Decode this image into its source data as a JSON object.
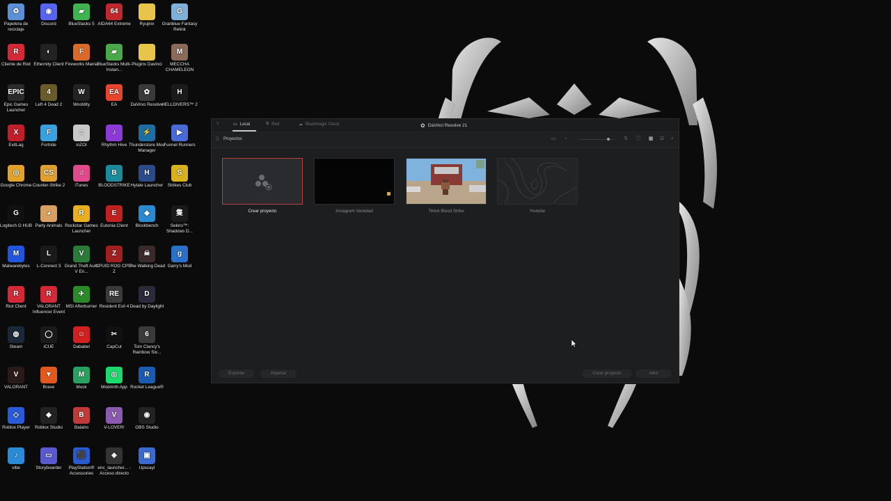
{
  "desktop": {
    "icons": [
      {
        "label": "Papelera de reciclaje",
        "icon": "recycle-bin-icon",
        "color": "#5b8fd6",
        "glyph": "♻"
      },
      {
        "label": "Discord",
        "icon": "discord-icon",
        "color": "#5865f2",
        "glyph": "◉"
      },
      {
        "label": "BlueStacks 5",
        "icon": "bluestacks-icon",
        "color": "#3fb34f",
        "glyph": "▰"
      },
      {
        "label": "AIDA64 Extreme",
        "icon": "aida64-icon",
        "color": "#c0282d",
        "glyph": "64"
      },
      {
        "label": "Ryujinx",
        "icon": "folder-icon",
        "color": "#e8c44a",
        "glyph": ""
      },
      {
        "label": "Granblue Fantasy Relink",
        "icon": "granblue-icon",
        "color": "#7fb0d8",
        "glyph": "G"
      },
      {
        "label": "Cliente de Riot",
        "icon": "riot-icon",
        "color": "#d32936",
        "glyph": "R"
      },
      {
        "label": "Ethernity Client",
        "icon": "ethernity-icon",
        "color": "#222222",
        "glyph": "◐"
      },
      {
        "label": "Fireworks Mania",
        "icon": "fireworks-icon",
        "color": "#d86a2a",
        "glyph": "F"
      },
      {
        "label": "BlueStacks Multi-Instan...",
        "icon": "bluestacks-multi-icon",
        "color": "#4aa84a",
        "glyph": "▰"
      },
      {
        "label": "Plugins Davinci",
        "icon": "folder-icon",
        "color": "#e8c44a",
        "glyph": ""
      },
      {
        "label": "MECCHA CHAMELEON",
        "icon": "meccha-icon",
        "color": "#8a6b5a",
        "glyph": "M"
      },
      {
        "label": "Epic Games Launcher",
        "icon": "epic-games-icon",
        "color": "#2b2b2b",
        "glyph": "EPIC"
      },
      {
        "label": "Left 4 Dead 2",
        "icon": "left4dead-icon",
        "color": "#6b5a2a",
        "glyph": "4"
      },
      {
        "label": "Wootility",
        "icon": "wootility-icon",
        "color": "#222222",
        "glyph": "W"
      },
      {
        "label": "EA",
        "icon": "ea-icon",
        "color": "#e8452c",
        "glyph": "EA"
      },
      {
        "label": "DaVinci Resolve",
        "icon": "davinci-icon",
        "color": "#3a3a3a",
        "glyph": "✿"
      },
      {
        "label": "HELLDIVERS™ 2",
        "icon": "helldivers-icon",
        "color": "#1a1a1a",
        "glyph": "H"
      },
      {
        "label": "ExitLag",
        "icon": "exitlag-icon",
        "color": "#c01f2a",
        "glyph": "X"
      },
      {
        "label": "Fortnite",
        "icon": "fortnite-icon",
        "color": "#3aa0e0",
        "glyph": "F"
      },
      {
        "label": "inZOI",
        "icon": "inzoi-icon",
        "color": "#c8c8c8",
        "glyph": "☺"
      },
      {
        "label": "Rhythm Hive",
        "icon": "rhythm-hive-icon",
        "color": "#8c3ad6",
        "glyph": "♪"
      },
      {
        "label": "Thunderstore Mod Manager",
        "icon": "thunderstore-icon",
        "color": "#1c6ea4",
        "glyph": "⚡"
      },
      {
        "label": "Funnel Runners",
        "icon": "funnel-runners-icon",
        "color": "#4a6ad6",
        "glyph": "▶"
      },
      {
        "label": "Google Chrome",
        "icon": "chrome-icon",
        "color": "#e0a22a",
        "glyph": "◎"
      },
      {
        "label": "Counter-Strike 2",
        "icon": "counter-strike-icon",
        "color": "#e0a030",
        "glyph": "CS"
      },
      {
        "label": "iTunes",
        "icon": "itunes-icon",
        "color": "#e04a8a",
        "glyph": "♫"
      },
      {
        "label": "BLOODSTRIKE",
        "icon": "bloodstrike-icon",
        "color": "#1c8a9a",
        "glyph": "B"
      },
      {
        "label": "Hytale Launcher",
        "icon": "hytale-icon",
        "color": "#2a4a8a",
        "glyph": "H"
      },
      {
        "label": "Strikes Club",
        "icon": "strikes-club-icon",
        "color": "#d8b020",
        "glyph": "S"
      },
      {
        "label": "Logitech G HUB",
        "icon": "logitech-icon",
        "color": "#111111",
        "glyph": "G"
      },
      {
        "label": "Party Animals",
        "icon": "party-animals-icon",
        "color": "#d8a060",
        "glyph": "◕"
      },
      {
        "label": "Rockstar Games Launcher",
        "icon": "rockstar-icon",
        "color": "#e8b020",
        "glyph": "R"
      },
      {
        "label": "Eutonia Client",
        "icon": "eutonia-icon",
        "color": "#c02020",
        "glyph": "E"
      },
      {
        "label": "Blockbench",
        "icon": "blockbench-icon",
        "color": "#2a8ad0",
        "glyph": "◆"
      },
      {
        "label": "Sekiro™: Shadows D...",
        "icon": "sekiro-icon",
        "color": "#1a1a1a",
        "glyph": "隻"
      },
      {
        "label": "Malwarebytes",
        "icon": "malwarebytes-icon",
        "color": "#2255dd",
        "glyph": "M"
      },
      {
        "label": "L-Connect 3",
        "icon": "lconnect-icon",
        "color": "#1a1a1a",
        "glyph": "L"
      },
      {
        "label": "Grand Theft Auto V En...",
        "icon": "gta-icon",
        "color": "#2a7a3a",
        "glyph": "V"
      },
      {
        "label": "CPUID ROG CPU-Z",
        "icon": "cpuz-icon",
        "color": "#a02020",
        "glyph": "Z"
      },
      {
        "label": "The Walking Dead",
        "icon": "walking-dead-icon",
        "color": "#3a2a2a",
        "glyph": "☠"
      },
      {
        "label": "Garry's Mod",
        "icon": "garrys-mod-icon",
        "color": "#2a70c8",
        "glyph": "g"
      },
      {
        "label": "Riot Client",
        "icon": "riot-icon",
        "color": "#d32936",
        "glyph": "R"
      },
      {
        "label": "VALORANT Influencer Event",
        "icon": "riot-icon",
        "color": "#d32936",
        "glyph": "R"
      },
      {
        "label": "MSI Afterburner",
        "icon": "msi-icon",
        "color": "#2a8a2a",
        "glyph": "✈"
      },
      {
        "label": "Resident Evil 4",
        "icon": "resident-evil-icon",
        "color": "#3a3a3a",
        "glyph": "RE"
      },
      {
        "label": "Dead by Daylight",
        "icon": "dbd-icon",
        "color": "#2a2a3a",
        "glyph": "D"
      },
      {
        "label": "Steam",
        "icon": "steam-icon",
        "color": "#1b2838",
        "glyph": "◍"
      },
      {
        "label": "iCUE",
        "icon": "icue-icon",
        "color": "#1a1a1a",
        "glyph": "◯"
      },
      {
        "label": "Dababel",
        "icon": "dababel-icon",
        "color": "#d02020",
        "glyph": "☺"
      },
      {
        "label": "CapCut",
        "icon": "capcut-icon",
        "color": "#111111",
        "glyph": "✂"
      },
      {
        "label": "Tom Clancy's Rainbow Six...",
        "icon": "rainbow-six-icon",
        "color": "#3a3a3a",
        "glyph": "6"
      },
      {
        "label": "VALORANT",
        "icon": "valorant-icon",
        "color": "#2a1a1a",
        "glyph": "V"
      },
      {
        "label": "Brave",
        "icon": "brave-icon",
        "color": "#e05a20",
        "glyph": "▼"
      },
      {
        "label": "Muck",
        "icon": "muck-icon",
        "color": "#2aa060",
        "glyph": "M"
      },
      {
        "label": "Modrinth App",
        "icon": "modrinth-icon",
        "color": "#1bd96a",
        "glyph": "◎"
      },
      {
        "label": "Rocket League®",
        "icon": "rocket-league-icon",
        "color": "#1a5ab0",
        "glyph": "R"
      },
      {
        "label": "Roblox Player",
        "icon": "roblox-icon",
        "color": "#2a5ad8",
        "glyph": "◇"
      },
      {
        "label": "Roblox Studio",
        "icon": "roblox-studio-icon",
        "color": "#222222",
        "glyph": "◆"
      },
      {
        "label": "Balatro",
        "icon": "balatro-icon",
        "color": "#c03a3a",
        "glyph": "B"
      },
      {
        "label": "V-LOVER!",
        "icon": "vlover-icon",
        "color": "#8a5ab0",
        "glyph": "V"
      },
      {
        "label": "OBS Studio",
        "icon": "obs-icon",
        "color": "#222222",
        "glyph": "◉"
      },
      {
        "label": "vibe",
        "icon": "vibe-icon",
        "color": "#2a8ad8",
        "glyph": "♪"
      },
      {
        "label": "Storyboarder",
        "icon": "storyboarder-icon",
        "color": "#5a5ad0",
        "glyph": "▭"
      },
      {
        "label": "PlayStation® Accessories",
        "icon": "playstation-icon",
        "color": "#2a5ad0",
        "glyph": "⬛"
      },
      {
        "label": "enc_launcher... - Acceso directo",
        "icon": "enc-launcher-icon",
        "color": "#333333",
        "glyph": "◈"
      },
      {
        "label": "Upscayl",
        "icon": "upscayl-icon",
        "color": "#3a6ad0",
        "glyph": "▣"
      }
    ]
  },
  "window": {
    "title": "DaVinci Resolve 21",
    "tabs": [
      {
        "label": "Local",
        "icon": "monitor-icon"
      },
      {
        "label": "Red",
        "icon": "network-icon"
      },
      {
        "label": "Blackmagic Cloud",
        "icon": "cloud-icon"
      }
    ],
    "close_glyph": "×",
    "section_title": "Proyectos",
    "projects": [
      {
        "name": "Crear proyecto",
        "kind": "new",
        "selected": true
      },
      {
        "name": "Instagram Variedad",
        "kind": "black",
        "selected": false
      },
      {
        "name": "Tiktok Blood Strike",
        "kind": "game",
        "selected": false
      },
      {
        "name": "Youtube",
        "kind": "topo",
        "selected": false
      }
    ],
    "buttons": {
      "export": "Exportar",
      "import": "Importar",
      "create": "Crear proyecto",
      "open": "Abrir"
    },
    "colors": {
      "selected_border": "#b3423a",
      "bg": "#1d1e20"
    }
  }
}
